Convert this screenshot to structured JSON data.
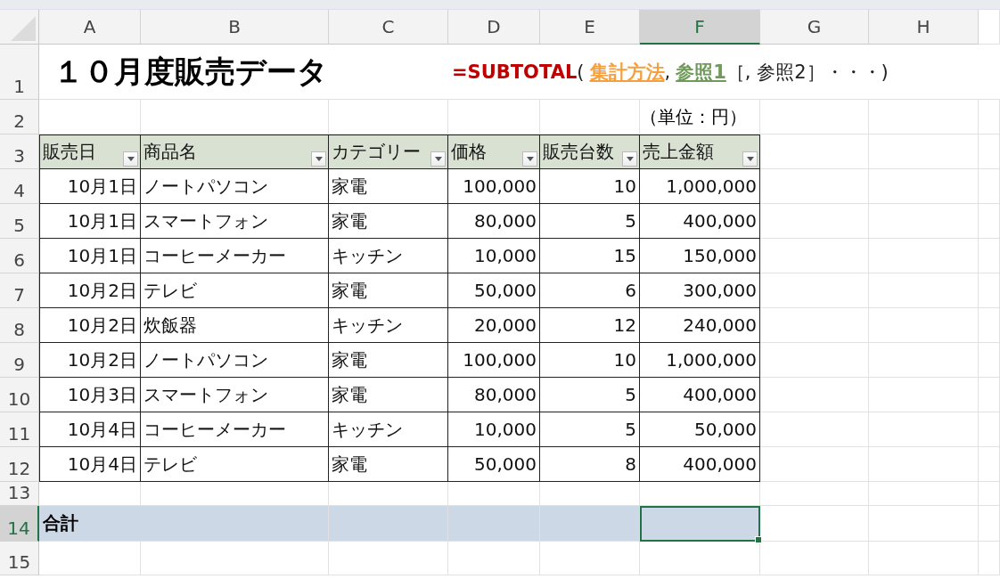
{
  "columns": [
    {
      "label": "A",
      "selected": false
    },
    {
      "label": "B",
      "selected": false
    },
    {
      "label": "C",
      "selected": false
    },
    {
      "label": "D",
      "selected": false
    },
    {
      "label": "E",
      "selected": false
    },
    {
      "label": "F",
      "selected": true
    },
    {
      "label": "G",
      "selected": false
    },
    {
      "label": "H",
      "selected": false
    }
  ],
  "row_numbers": [
    {
      "label": "1",
      "selected": false
    },
    {
      "label": "2",
      "selected": false
    },
    {
      "label": "3",
      "selected": false
    },
    {
      "label": "4",
      "selected": false
    },
    {
      "label": "5",
      "selected": false
    },
    {
      "label": "6",
      "selected": false
    },
    {
      "label": "7",
      "selected": false
    },
    {
      "label": "8",
      "selected": false
    },
    {
      "label": "9",
      "selected": false
    },
    {
      "label": "10",
      "selected": false
    },
    {
      "label": "11",
      "selected": false
    },
    {
      "label": "12",
      "selected": false
    },
    {
      "label": "13",
      "selected": false
    },
    {
      "label": "14",
      "selected": true
    },
    {
      "label": "15",
      "selected": false
    }
  ],
  "title": "１０月度販売データ",
  "formula": [
    {
      "text": "=SUBTOTAL",
      "kind": "function"
    },
    {
      "text": "(",
      "kind": "plain"
    },
    {
      "text": "集計方法",
      "kind": "arg1"
    },
    {
      "text": ",",
      "kind": "plain"
    },
    {
      "text": "参照1",
      "kind": "arg2"
    },
    {
      "text": "［, 参照2］・・・)",
      "kind": "plain"
    }
  ],
  "unit": "（単位：円）",
  "table": {
    "headers": [
      "販売日",
      "商品名",
      "カテゴリー",
      "価格",
      "販売台数",
      "売上金額"
    ],
    "rows": [
      [
        "10月1日",
        "ノートパソコン",
        "家電",
        "100,000",
        "10",
        "1,000,000"
      ],
      [
        "10月1日",
        "スマートフォン",
        "家電",
        "80,000",
        "5",
        "400,000"
      ],
      [
        "10月1日",
        "コーヒーメーカー",
        "キッチン",
        "10,000",
        "15",
        "150,000"
      ],
      [
        "10月2日",
        "テレビ",
        "家電",
        "50,000",
        "6",
        "300,000"
      ],
      [
        "10月2日",
        "炊飯器",
        "キッチン",
        "20,000",
        "12",
        "240,000"
      ],
      [
        "10月2日",
        "ノートパソコン",
        "家電",
        "100,000",
        "10",
        "1,000,000"
      ],
      [
        "10月3日",
        "スマートフォン",
        "家電",
        "80,000",
        "5",
        "400,000"
      ],
      [
        "10月4日",
        "コーヒーメーカー",
        "キッチン",
        "10,000",
        "5",
        "50,000"
      ],
      [
        "10月4日",
        "テレビ",
        "家電",
        "50,000",
        "8",
        "400,000"
      ]
    ]
  },
  "total": {
    "label": "合計"
  }
}
